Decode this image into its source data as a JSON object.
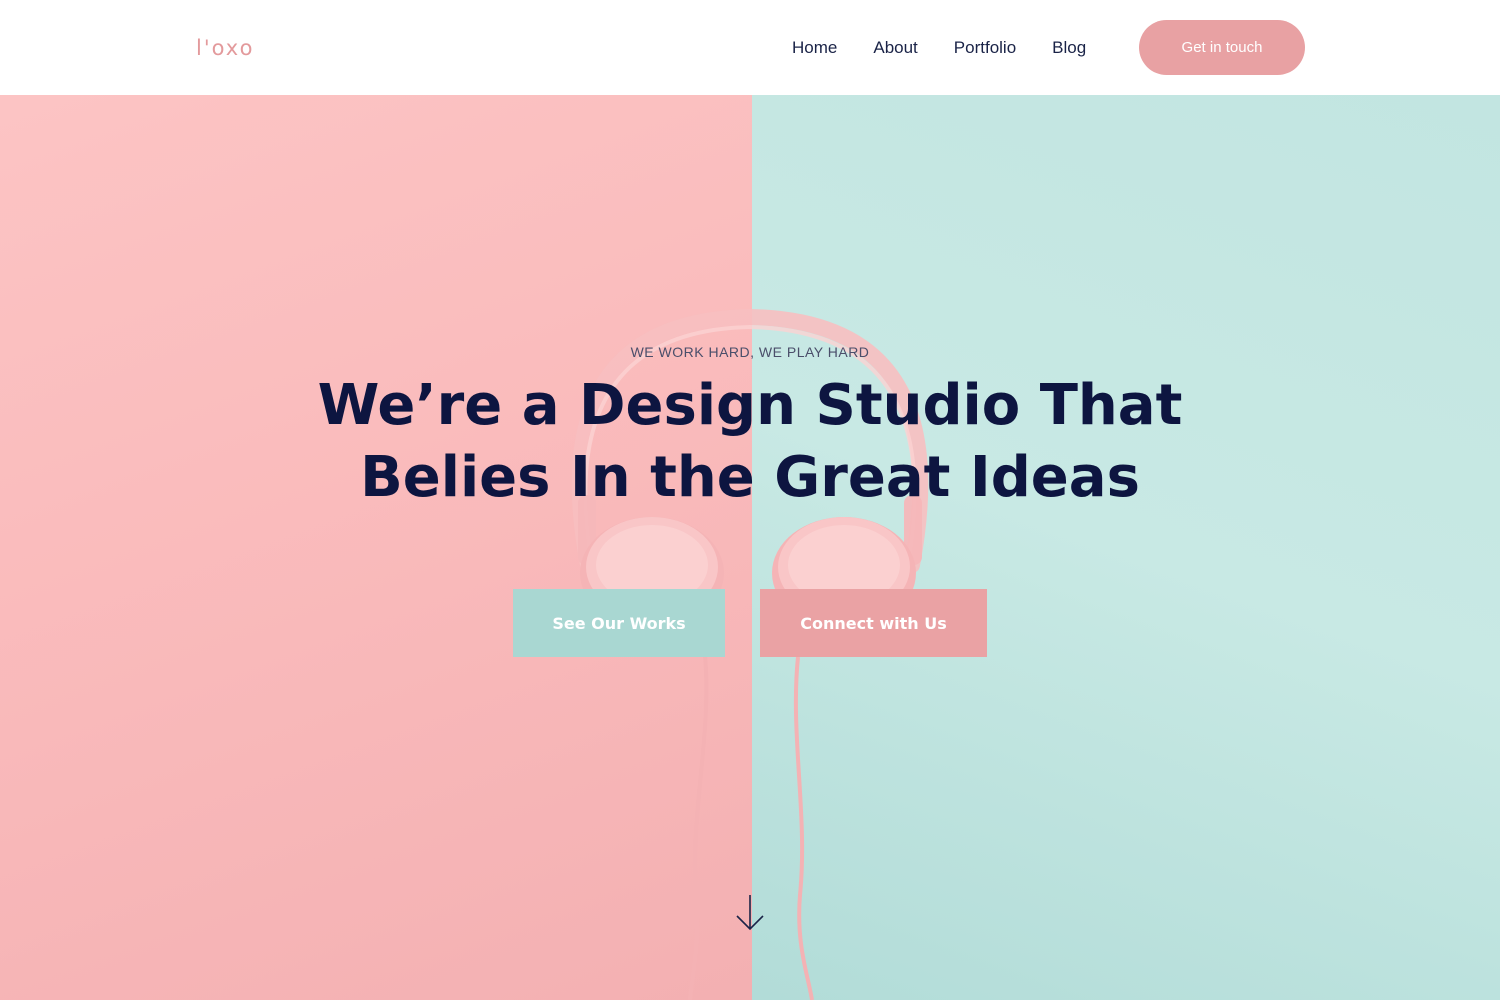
{
  "brand": {
    "logo_text": "l'oxo",
    "accent": "#e8a1a3",
    "mint": "#a9d7d2",
    "navy": "#0d1540"
  },
  "nav": {
    "links": [
      {
        "label": "Home"
      },
      {
        "label": "About"
      },
      {
        "label": "Portfolio"
      },
      {
        "label": "Blog"
      }
    ],
    "cta_label": "Get in touch"
  },
  "hero": {
    "eyebrow": "WE WORK HARD, WE PLAY HARD",
    "headline_line1": "We’re a Design Studio That",
    "headline_line2": "Belies In the Great Ideas",
    "primary_button": "See Our Works",
    "secondary_button": "Connect with Us",
    "scroll_icon": "arrow-down-icon",
    "left_bg": "#f9b9ba",
    "right_bg": "#c2e5e1"
  }
}
